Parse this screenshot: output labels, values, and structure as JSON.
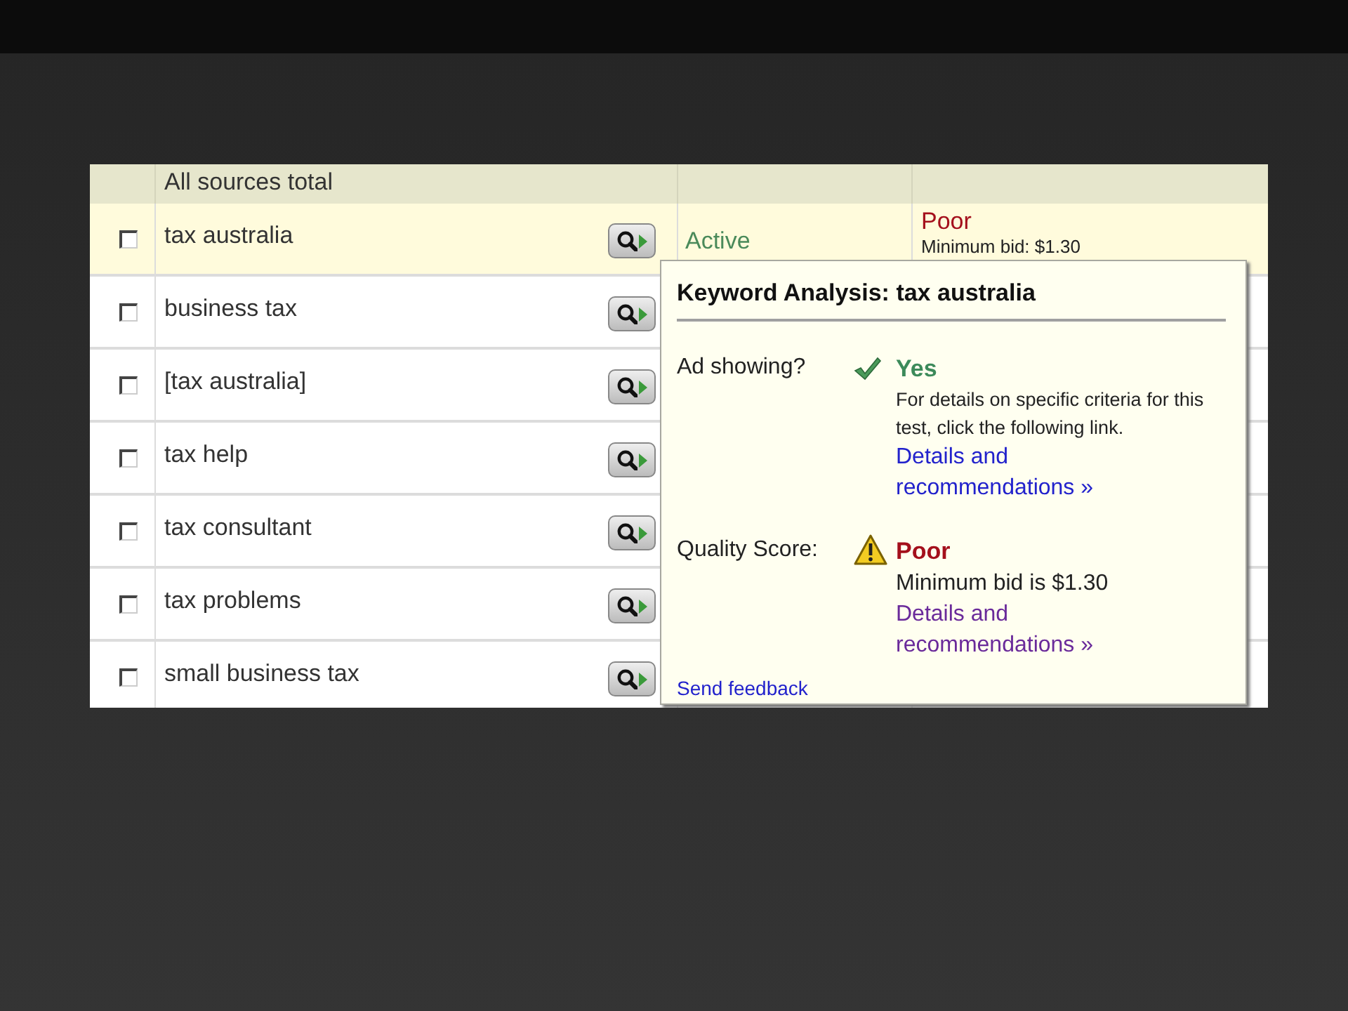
{
  "table": {
    "header": {
      "label": "All sources total"
    },
    "rows": [
      {
        "checked": false,
        "keyword": "tax australia",
        "selected": true,
        "status": "Active",
        "quality": "Poor",
        "quality_note": "Minimum bid: $1.30"
      },
      {
        "checked": false,
        "keyword": "business tax",
        "selected": false
      },
      {
        "checked": false,
        "keyword": "[tax australia]",
        "selected": false
      },
      {
        "checked": false,
        "keyword": "tax help",
        "selected": false
      },
      {
        "checked": false,
        "keyword": "tax consultant",
        "selected": false
      },
      {
        "checked": false,
        "keyword": "tax problems",
        "selected": false
      },
      {
        "checked": false,
        "keyword": "small business tax",
        "selected": false
      }
    ]
  },
  "popup": {
    "title": "Keyword Analysis: tax australia",
    "items": [
      {
        "kind": "check",
        "label": "Ad showing?",
        "value": "Yes",
        "description": "For details on specific criteria for this test, click the following link.",
        "link": "Details and recommendations »",
        "visited": false
      },
      {
        "kind": "warning",
        "label": "Quality Score:",
        "value": "Poor",
        "description": "Minimum bid is $1.30",
        "link": "Details and recommendations »",
        "visited": true
      }
    ],
    "feedback_link": "Send feedback"
  }
}
